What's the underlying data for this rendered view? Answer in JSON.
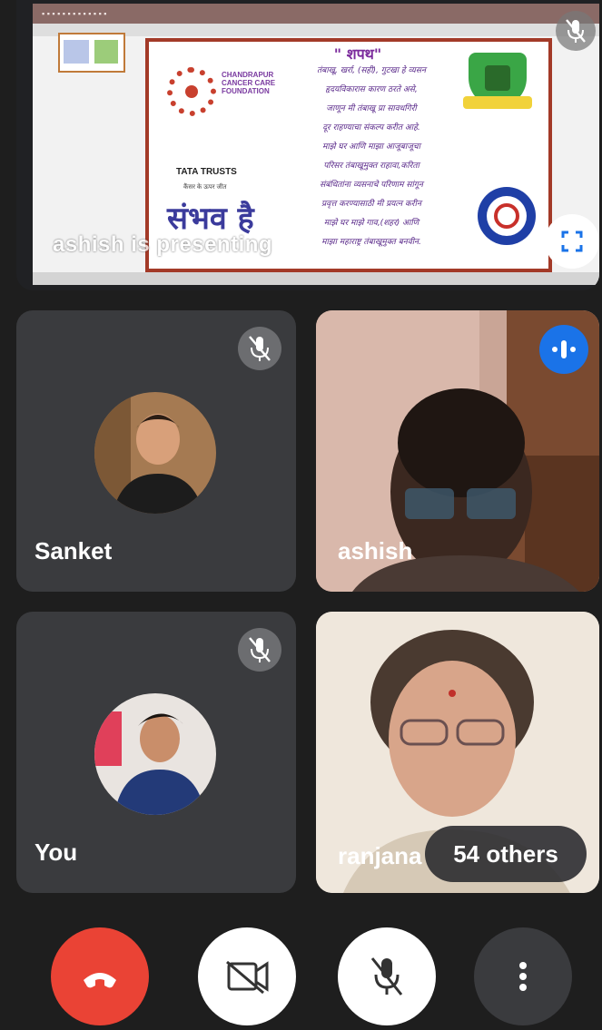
{
  "presentation": {
    "presenter_text": "ashish is presenting",
    "slide": {
      "oath_title": "\" शपथ\"",
      "oath_lines": [
        "तंबाखू, खर्रा, (सही), गुटखा हे व्यसन",
        "हृदयविकारास कारण ठरते असे,",
        "जाणून मी तंबाखू प्रा सावधगिरी",
        "दूर राहण्याचा संकल्प करीत आहे.",
        "माझे घर आणि माझा आजूबाजूचा",
        "परिसर तंबाखूमुक्त राहावा,करिता",
        "संबंधितांना व्यसनाचे परिणाम सांगून",
        "प्रवृत्त करण्यासाठी मी प्रयत्न करीन",
        "माझे घर माझे गाव,(शहर) आणि",
        "माझा महाराष्ट्र तंबाखूमुक्त बनवीन."
      ],
      "foundation_name": "CHANDRAPUR CANCER CARE FOUNDATION",
      "sponsor": "TATA TRUSTS",
      "sponsor_sub": "कैंसर के ऊपर जीत",
      "tagline": "संभव है"
    },
    "mute_icon": "mic-off-icon",
    "fullscreen_icon": "fullscreen-icon"
  },
  "participants": [
    {
      "name": "Sanket",
      "muted": true,
      "speaking": false
    },
    {
      "name": "ashish",
      "muted": false,
      "speaking": true
    },
    {
      "name": "You",
      "muted": true,
      "speaking": false
    },
    {
      "name": "ranjana",
      "muted": false,
      "speaking": false
    }
  ],
  "others_badge": "54 others",
  "colors": {
    "end_call": "#ea4335",
    "speaking": "#1a73e8",
    "tile_bg": "#3a3b3e",
    "background": "#1e1e1e"
  },
  "controls": {
    "end_call_icon": "phone-hangup-icon",
    "camera_icon": "camera-off-icon",
    "mic_icon": "mic-off-icon",
    "more_icon": "more-vert-icon"
  }
}
